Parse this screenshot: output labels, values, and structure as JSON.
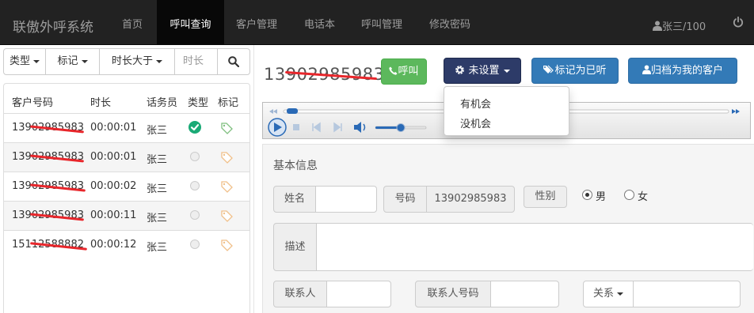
{
  "app": {
    "title": "联傲外呼系统"
  },
  "nav": {
    "items": [
      "首页",
      "呼叫查询",
      "客户管理",
      "电话本",
      "呼叫管理",
      "修改密码"
    ],
    "user": "张三/100"
  },
  "filter": {
    "type_label": "类型",
    "mark_label": "标记",
    "duration_label": "时长大于",
    "duration_placeholder": "时长"
  },
  "table": {
    "headers": [
      "客户号码",
      "时长",
      "话务员",
      "类型",
      "标记"
    ],
    "rows": [
      {
        "number": "13902985983",
        "duration": "00:00:01",
        "agent": "张三",
        "type": "checked"
      },
      {
        "number": "13902985983",
        "duration": "00:00:01",
        "agent": "张三",
        "type": "unset"
      },
      {
        "number": "13902985983",
        "duration": "00:00:02",
        "agent": "张三",
        "type": "unset"
      },
      {
        "number": "13902985983",
        "duration": "00:00:11",
        "agent": "张三",
        "type": "unset"
      },
      {
        "number": "15112588882",
        "duration": "00:00:12",
        "agent": "张三",
        "type": "unset"
      }
    ]
  },
  "detail": {
    "phone": "13902985983",
    "call_button": "呼叫",
    "status_button": "未设置",
    "listened_button": "标记为已听",
    "archive_button": "归档为我的客户",
    "status_menu": [
      "有机会",
      "没机会"
    ],
    "player": {
      "volume": 0.5,
      "progress": 0.0
    }
  },
  "info": {
    "title": "基本信息",
    "name_label": "姓名",
    "name_value": "",
    "number_label": "号码",
    "number_value": "13902985983",
    "gender_label": "性别",
    "gender_options": [
      "男",
      "女"
    ],
    "gender_selected": "男",
    "desc_label": "描述",
    "desc_value": "",
    "contact_label": "联系人",
    "contact_value": "",
    "contact_number_label": "联系人号码",
    "contact_number_value": "",
    "relation_label": "关系",
    "relation_value": ""
  },
  "colors": {
    "navbar": "#222222",
    "call": "#5cb85c",
    "status": "#2d3b68",
    "primary": "#337ab7",
    "checked": "#1aaa76",
    "redaction": "#e8262b"
  }
}
